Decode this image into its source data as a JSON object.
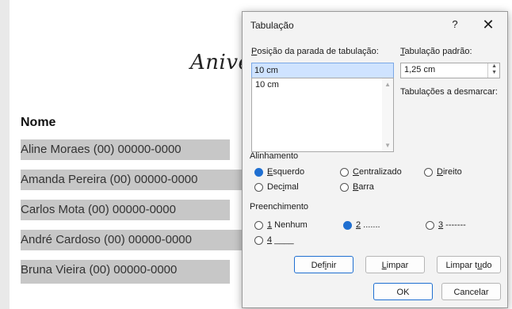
{
  "document": {
    "title": "Aniver",
    "heading": "Nome",
    "lines": [
      "Aline Moraes (00) 00000-0000",
      "Amanda Pereira (00) 00000-0000",
      "Carlos Mota (00) 00000-0000",
      "André Cardoso (00) 00000-0000",
      "Bruna Vieira (00) 00000-0000"
    ]
  },
  "dialog": {
    "title": "Tabulação",
    "help": "?",
    "close": "✕",
    "tab_position_label_u": "P",
    "tab_position_label_rest": "osição da parada de tabulação:",
    "tab_position_value": "10 cm",
    "tab_list": [
      "10 cm"
    ],
    "default_tab_label_u": "T",
    "default_tab_label_rest": "abulação padrão:",
    "default_tab_value": "1,25 cm",
    "clear_label": "Tabulações a desmarcar:",
    "alignment": {
      "label": "Alinhamento",
      "options": [
        {
          "u": "E",
          "rest": "squerdo",
          "selected": true
        },
        {
          "u": "C",
          "rest": "entralizado",
          "selected": false
        },
        {
          "u": "D",
          "rest": "ireito",
          "selected": false
        },
        {
          "pre": "Dec",
          "u": "i",
          "rest": "mal",
          "selected": false
        },
        {
          "u": "B",
          "rest": "arra",
          "selected": false
        }
      ]
    },
    "leader": {
      "label": "Preenchimento",
      "options": [
        {
          "u": "1",
          "rest": " Nenhum",
          "selected": false
        },
        {
          "u": "2",
          "rest": " .......",
          "selected": true
        },
        {
          "u": "3",
          "rest": " -------",
          "selected": false
        },
        {
          "u": "4",
          "rest": " ____",
          "selected": false
        }
      ]
    },
    "buttons": {
      "set": {
        "pre": "Def",
        "u": "i",
        "rest": "nir"
      },
      "clear": {
        "pre": "",
        "u": "L",
        "rest": "impar"
      },
      "clear_all": {
        "pre": "Limpar t",
        "u": "u",
        "rest": "do"
      },
      "ok": "OK",
      "cancel": "Cancelar"
    }
  }
}
